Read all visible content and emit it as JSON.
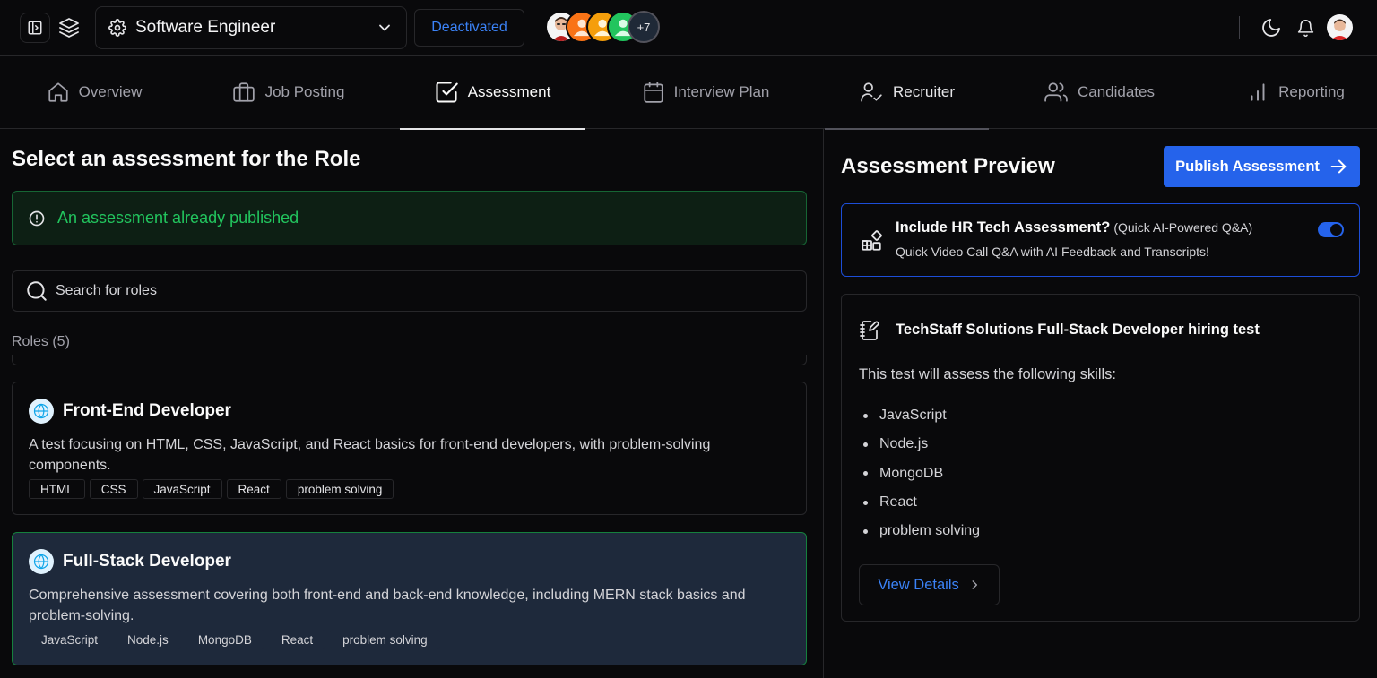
{
  "header": {
    "role_select": {
      "value": "Software Engineer",
      "icon": "gear-icon"
    },
    "status_badge": "Deactivated",
    "collaborators": {
      "more_count": "+7"
    }
  },
  "tabs": [
    {
      "label": "Overview",
      "icon": "home-icon"
    },
    {
      "label": "Job Posting",
      "icon": "briefcase-icon"
    },
    {
      "label": "Assessment",
      "icon": "checkbox-icon"
    },
    {
      "label": "Interview Plan",
      "icon": "calendar-icon"
    },
    {
      "label": "Recruiter",
      "icon": "user-check-icon"
    },
    {
      "label": "Candidates",
      "icon": "users-icon"
    },
    {
      "label": "Reporting",
      "icon": "bar-chart-icon"
    }
  ],
  "active_tab": "Assessment",
  "left": {
    "title": "Select an assessment for the Role",
    "alert": "An assessment already published",
    "search": {
      "placeholder": "Search for roles",
      "value": ""
    },
    "roles_count": "Roles (5)",
    "roles": [
      {
        "title": "Front-End Developer",
        "description": "A test focusing on HTML, CSS, JavaScript, and React basics for front-end developers, with problem-solving components.",
        "tags": [
          "HTML",
          "CSS",
          "JavaScript",
          "React",
          "problem solving"
        ]
      },
      {
        "title": "Full-Stack Developer",
        "description": "Comprehensive assessment covering both front-end and back-end knowledge, including MERN stack basics and problem-solving.",
        "tags": [
          "JavaScript",
          "Node.js",
          "MongoDB",
          "React",
          "problem solving"
        ],
        "selected": true
      }
    ]
  },
  "right": {
    "title": "Assessment Preview",
    "publish_label": "Publish Assessment",
    "hr": {
      "title": "Include HR Tech Assessment?",
      "subtitle": "(Quick AI-Powered Q&A)",
      "description": "Quick Video Call Q&A with AI Feedback and Transcripts!",
      "enabled": true
    },
    "test": {
      "title": "TechStaff Solutions Full-Stack Developer hiring test",
      "intro": "This test will assess the following skills:",
      "skills": [
        "JavaScript",
        "Node.js",
        "MongoDB",
        "React",
        "problem solving"
      ],
      "view_label": "View Details"
    }
  },
  "colors": {
    "accent": "#2563eb",
    "success": "#22c55e",
    "background": "#09090b"
  }
}
